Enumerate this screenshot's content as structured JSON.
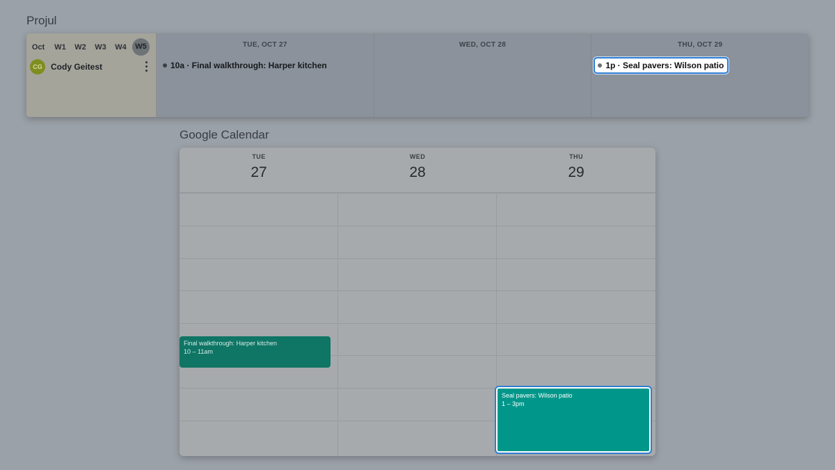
{
  "projul": {
    "title": "Projul",
    "month_label": "Oct",
    "week_tabs": [
      "W1",
      "W2",
      "W3",
      "W4",
      "W5"
    ],
    "active_week": "W5",
    "user": {
      "initials": "CG",
      "name": "Cody Geitest"
    },
    "days": [
      {
        "header": "TUE, OCT 27",
        "event": "10a · Final walkthrough: Harper kitchen"
      },
      {
        "header": "WED, OCT 28",
        "event": ""
      },
      {
        "header": "THU, OCT 29",
        "event": "1p · Seal pavers: Wilson patio"
      }
    ]
  },
  "gcal": {
    "title": "Google Calendar",
    "days": [
      {
        "dow": "TUE",
        "num": "27"
      },
      {
        "dow": "WED",
        "num": "28"
      },
      {
        "dow": "THU",
        "num": "29"
      }
    ],
    "events": [
      {
        "title": "Final walkthrough: Harper kitchen",
        "time": "10 – 11am"
      },
      {
        "title": "Seal pavers: Wilson patio",
        "time": "1 – 3pm"
      }
    ]
  },
  "colors": {
    "accent_blue": "#2f7dd3",
    "event_green_dark": "#0f7565",
    "event_green": "#00978a"
  }
}
